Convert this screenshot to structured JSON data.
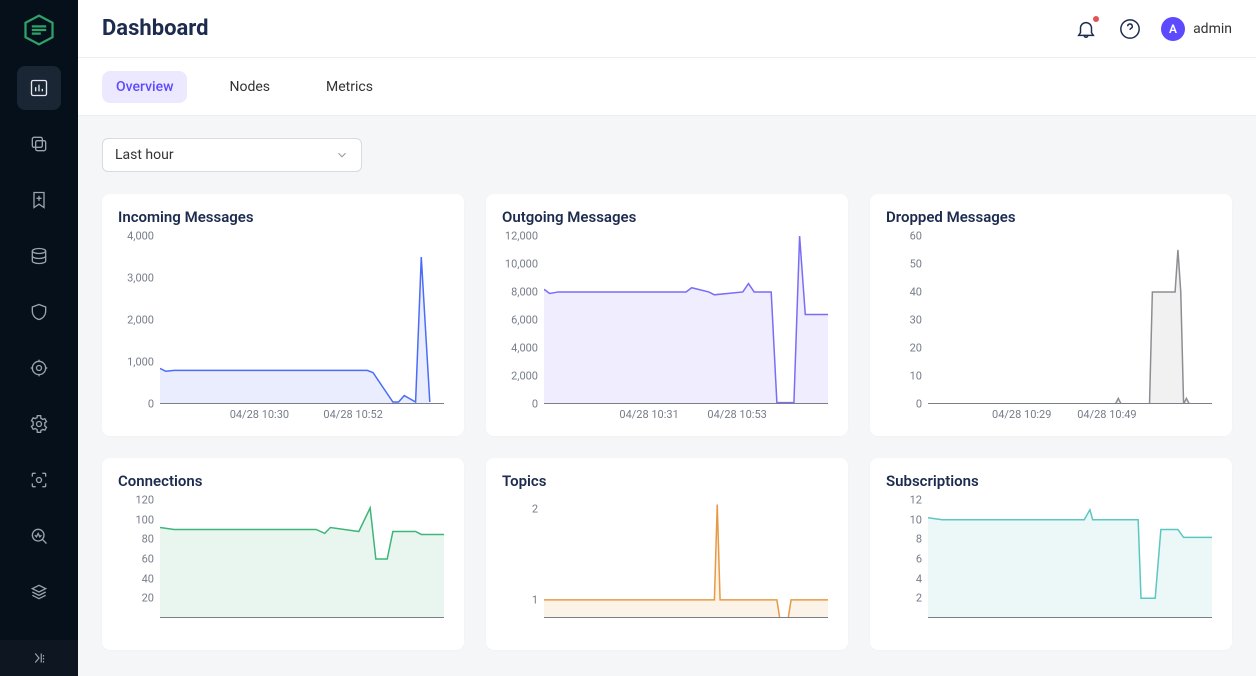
{
  "header": {
    "title": "Dashboard",
    "username": "admin",
    "avatar_letter": "A"
  },
  "tabs": [
    {
      "label": "Overview",
      "active": true
    },
    {
      "label": "Nodes",
      "active": false
    },
    {
      "label": "Metrics",
      "active": false
    }
  ],
  "timerange": {
    "selected": "Last hour"
  },
  "cards": {
    "incoming": {
      "title": "Incoming Messages"
    },
    "outgoing": {
      "title": "Outgoing Messages"
    },
    "dropped": {
      "title": "Dropped Messages"
    },
    "connections": {
      "title": "Connections"
    },
    "topics": {
      "title": "Topics"
    },
    "subscriptions": {
      "title": "Subscriptions"
    }
  },
  "colors": {
    "incoming": "#4a6cf7",
    "outgoing": "#7a6cf7",
    "dropped": "#8d8e92",
    "connections": "#3eb57a",
    "topics": "#e79a45",
    "subscriptions": "#5cc7c0"
  },
  "chart_data": [
    {
      "id": "incoming",
      "type": "area",
      "title": "Incoming Messages",
      "ylim": [
        0,
        4000
      ],
      "yticks": [
        0,
        1000,
        2000,
        3000,
        4000
      ],
      "xticks": [
        "04/28 10:30",
        "04/28 10:52"
      ],
      "xtick_pos": [
        0.35,
        0.68
      ],
      "x": [
        0.0,
        0.02,
        0.05,
        0.73,
        0.75,
        0.82,
        0.84,
        0.86,
        0.9,
        0.92,
        0.95
      ],
      "y": [
        850,
        780,
        800,
        800,
        750,
        50,
        50,
        200,
        50,
        3500,
        50
      ]
    },
    {
      "id": "outgoing",
      "type": "area",
      "title": "Outgoing Messages",
      "ylim": [
        0,
        12000
      ],
      "yticks": [
        0,
        2000,
        4000,
        6000,
        8000,
        10000,
        12000
      ],
      "xticks": [
        "04/28 10:31",
        "04/28 10:53"
      ],
      "xtick_pos": [
        0.37,
        0.68
      ],
      "x": [
        0.0,
        0.02,
        0.05,
        0.5,
        0.52,
        0.58,
        0.6,
        0.7,
        0.72,
        0.74,
        0.8,
        0.82,
        0.88,
        0.9,
        0.92,
        1.0
      ],
      "y": [
        8200,
        7900,
        8000,
        8000,
        8300,
        8000,
        7800,
        8000,
        8600,
        8000,
        8000,
        100,
        100,
        12000,
        6400,
        6400
      ]
    },
    {
      "id": "dropped",
      "type": "area",
      "title": "Dropped Messages",
      "ylim": [
        0,
        60
      ],
      "yticks": [
        0,
        10,
        20,
        30,
        40,
        50,
        60
      ],
      "xticks": [
        "04/28 10:29",
        "04/28 10:49"
      ],
      "xtick_pos": [
        0.33,
        0.63
      ],
      "x": [
        0.0,
        0.66,
        0.67,
        0.68,
        0.78,
        0.79,
        0.87,
        0.88,
        0.89,
        0.9,
        0.91,
        0.92,
        0.93,
        0.94,
        1.0
      ],
      "y": [
        0,
        0,
        2,
        0,
        0,
        40,
        40,
        55,
        40,
        0,
        2,
        0,
        0,
        0,
        0
      ]
    },
    {
      "id": "connections",
      "type": "area",
      "title": "Connections",
      "ylim": [
        0,
        120
      ],
      "yticks": [
        20,
        40,
        60,
        80,
        100,
        120
      ],
      "xticks": [],
      "xtick_pos": [],
      "x": [
        0.0,
        0.05,
        0.55,
        0.58,
        0.6,
        0.7,
        0.74,
        0.76,
        0.8,
        0.82,
        0.9,
        0.92,
        1.0
      ],
      "y": [
        92,
        90,
        90,
        86,
        92,
        88,
        112,
        60,
        60,
        88,
        88,
        85,
        85
      ]
    },
    {
      "id": "topics",
      "type": "area",
      "title": "Topics",
      "ylim": [
        0.8,
        2.1
      ],
      "yticks": [
        1,
        2
      ],
      "xticks": [],
      "xtick_pos": [],
      "x": [
        0.0,
        0.6,
        0.61,
        0.62,
        0.63,
        0.82,
        0.83,
        0.86,
        0.87,
        0.9,
        1.0
      ],
      "y": [
        1.0,
        1.0,
        2.05,
        1.0,
        1.0,
        1.0,
        0.8,
        0.8,
        1.0,
        1.0,
        1.0
      ]
    },
    {
      "id": "subscriptions",
      "type": "area",
      "title": "Subscriptions",
      "ylim": [
        0,
        12
      ],
      "yticks": [
        2,
        4,
        6,
        8,
        10,
        12
      ],
      "xticks": [],
      "xtick_pos": [],
      "x": [
        0.0,
        0.05,
        0.55,
        0.57,
        0.58,
        0.74,
        0.75,
        0.8,
        0.82,
        0.88,
        0.9,
        1.0
      ],
      "y": [
        10.2,
        10.0,
        10.0,
        11.0,
        10.0,
        10.0,
        2.0,
        2.0,
        9.0,
        9.0,
        8.2,
        8.2
      ]
    }
  ]
}
